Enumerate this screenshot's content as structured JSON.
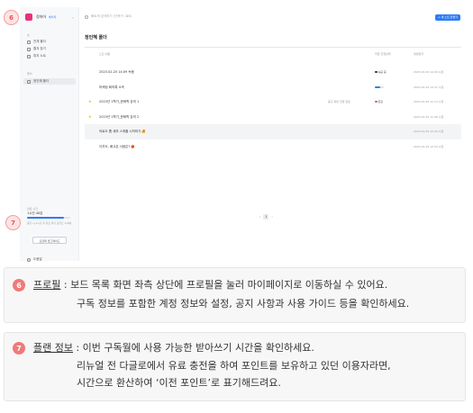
{
  "app": {
    "profile_name": "정마아",
    "plan_badge": "베이직",
    "search_placeholder": "빠르게 검색하기 (단축키: ⌘K)",
    "new_button": "+ 새 노트 만들기",
    "section_home": "홈",
    "nav": [
      {
        "label": "전체 폴더"
      },
      {
        "label": "즐겨 찾기"
      },
      {
        "label": "휴지 노트"
      }
    ],
    "section_board": "폴더",
    "active_board": "정인혜 폴더",
    "board_title": "정인혜 폴더",
    "columns": {
      "name": "노트 이름",
      "status": "작업 진행상태",
      "date": "생성일자"
    },
    "rows": [
      {
        "title": "2023.02.20 14:09 녹음",
        "status": "녹음 중",
        "date": "2023.02.20 14:09 수정"
      },
      {
        "title": "마케팅 회의록 소속",
        "progress": 0.6,
        "date": "2023.02.20 13:47 수정"
      },
      {
        "title": "2023년 1학기_문화학 강의 1",
        "mid": "중간 화면 전환 완료",
        "status": "완료",
        "date": "2023.01.25 11:14 수정"
      },
      {
        "title": "2023년 1학기_문화학 강의 2",
        "date": "2023.01.25 11:08 수정"
      },
      {
        "title": "의료도 웹 세부 스케줄 시작하기 🍊",
        "date": "2023.01.25 13:20 수정"
      },
      {
        "title": "이끼도, 배고픈 사람은? 🍎",
        "date": "2023.01.25 12:54 수정"
      }
    ],
    "page_current": "1",
    "usage_label": "남은 시간",
    "usage_time": "1시간 40분",
    "usage_fraction": 0.85,
    "usage_note": "충전 시 2시간 후 만료 이전 포인트 110분",
    "upgrade_button": "요금제 업그레이드",
    "help": "도움말"
  },
  "markers": {
    "profile": "6",
    "plan": "7"
  },
  "notes": [
    {
      "num": "6",
      "key": "프로필",
      "line1": " : 보드 목록 화면 좌측 상단에 프로필을 눌러 마이페이지로 이동하실 수 있어요.",
      "line2": "구독 정보를 포함한 계정 정보와 설정, 공지 사항과 사용 가이드 등을 확인하세요."
    },
    {
      "num": "7",
      "key": "플랜 정보",
      "line1": " : 이번 구독월에 사용 가능한 받아쓰기 시간을 확인하세요.",
      "line2": "리뉴얼 전 다글로에서 유료 충전을 하여 포인트를 보유하고 있던 이용자라면,",
      "line3": "시간으로 환산하여 ‘이전 포인트’로 표기해드려요."
    }
  ],
  "colors": {
    "accent": "#2f7cf6",
    "marker": "#f07a7a",
    "avatar": "#e8327c"
  }
}
